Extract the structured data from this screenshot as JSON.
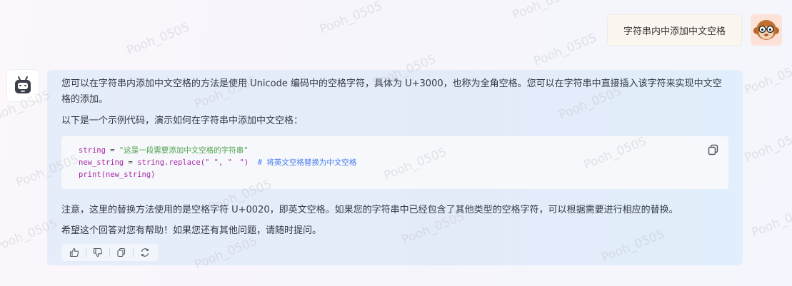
{
  "user_message": {
    "text": "字符串内中添加中文空格"
  },
  "bot_message": {
    "paragraph1": "您可以在字符串内添加中文空格的方法是使用 Unicode 编码中的空格字符，具体为 U+3000，也称为全角空格。您可以在字符串中直接插入该字符来实现中文空格的添加。",
    "paragraph2": "以下是一个示例代码，演示如何在字符串中添加中文空格：",
    "code": {
      "line1_var": "string",
      "line1_op": " = ",
      "line1_str": "\"这是一段需要添加中文空格的字符串\"",
      "line2_var": "new_string",
      "line2_op": " = ",
      "line2_call": "string.replace(\" \", \"　\")",
      "line2_comment": "  # 将英文空格替换为中文空格",
      "line3": "print(new_string)"
    },
    "paragraph3": "注意，这里的替换方法使用的是空格字符 U+0020，即英文空格。如果您的字符串中已经包含了其他类型的空格字符，可以根据需要进行相应的替换。",
    "paragraph4": "希望这个回答对您有帮助！如果您还有其他问题，请随时提问。"
  },
  "actions": {
    "icons": [
      "thumbs-up-icon",
      "thumbs-down-icon",
      "copy-icon",
      "refresh-icon"
    ]
  },
  "watermark": {
    "text": "Pooh_0505"
  },
  "colors": {
    "code_keyword": "#a626a4",
    "code_string": "#50a14f",
    "code_comment": "#4078f2",
    "bot_card_bg": "#e4ecfa",
    "user_bubble_bg": "#fbf6ef"
  }
}
